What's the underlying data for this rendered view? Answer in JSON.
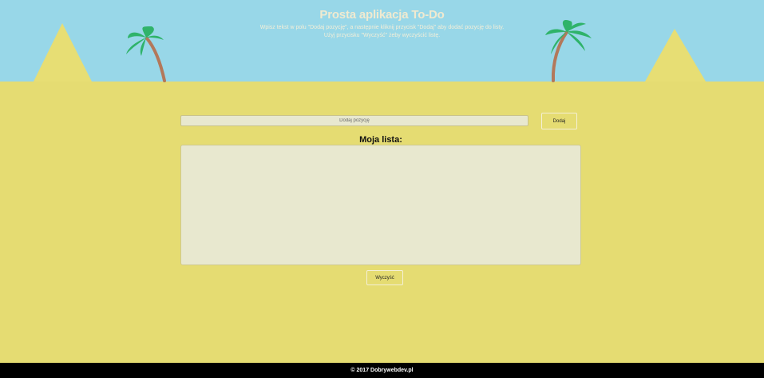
{
  "header": {
    "title": "Prosta aplikacja To-Do",
    "instructions_line1": "Wpisz tekst w polu \"Dodaj pozycję\", a następnie kliknij przycisk \"Dodaj\" aby dodać pozycję do listy.",
    "instructions_line2": "Użyj przycisku \"Wyczyść\" żeby wyczyścić listę."
  },
  "form": {
    "input_value": "",
    "input_placeholder": "Dodaj pozycję",
    "add_label": "Dodaj"
  },
  "list": {
    "title": "Moja lista:",
    "items": []
  },
  "clear_label": "Wyczyść",
  "footer": {
    "text": "© 2017 Dobrywebdev.pl"
  },
  "colors": {
    "sky": "#98d7e8",
    "sand": "#e5dc72",
    "pyramid": "#e7de74",
    "palm_leaf": "#2fb36a",
    "palm_trunk": "#b3785a",
    "panel": "#e8e8cf",
    "footer_bg": "#000000"
  },
  "decorations": {
    "left_pyramid": "pyramid-icon",
    "right_pyramid": "pyramid-icon",
    "left_palm": "palm-tree-icon",
    "right_palm": "palm-tree-icon"
  }
}
